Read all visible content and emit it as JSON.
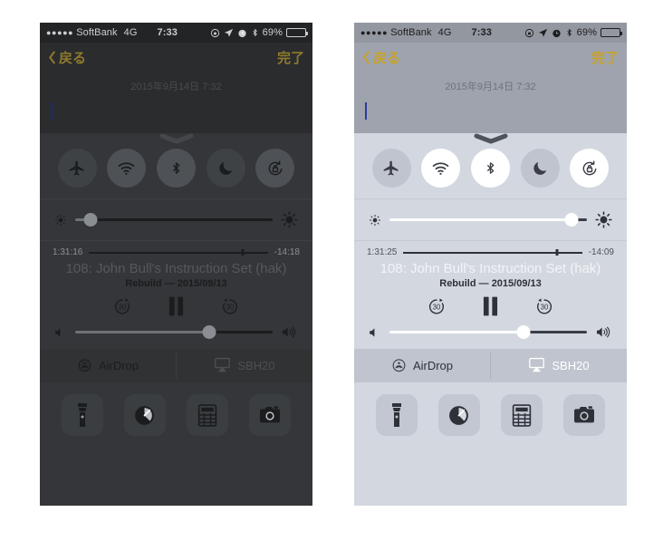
{
  "panels": [
    {
      "id": "left",
      "theme": "dark-dimmed",
      "status_bar": {
        "signal_dots": "●●●●●",
        "carrier": "SoftBank",
        "network": "4G",
        "time": "7:33",
        "battery_percent": "69%",
        "battery_level": 69,
        "icons": [
          "rotation-lock-icon",
          "location-arrow-icon",
          "alarm-clock-icon",
          "bluetooth-icon",
          "battery-icon"
        ]
      },
      "nav_bar": {
        "back_label": "戻る",
        "done_label": "完了"
      },
      "note": {
        "date_text": "2015年9月14日 7:32",
        "cursor_visible": true
      },
      "control_center": {
        "toggles": [
          {
            "name": "airplane-mode",
            "icon": "airplane-icon",
            "on": false
          },
          {
            "name": "wifi",
            "icon": "wifi-icon",
            "on": true
          },
          {
            "name": "bluetooth",
            "icon": "bluetooth-icon",
            "on": true
          },
          {
            "name": "do-not-disturb",
            "icon": "moon-icon",
            "on": false
          },
          {
            "name": "rotation-lock",
            "icon": "rotation-lock-icon",
            "on": true
          }
        ],
        "brightness": {
          "value": 8
        },
        "media": {
          "elapsed": "1:31:16",
          "remaining": "-14:18",
          "progress": 86,
          "title": "108: John Bull's Instruction Set (hak)",
          "subtitle": "Rebuild — 2015/09/13",
          "skip_back_label": "30",
          "skip_forward_label": "30",
          "playback_state": "playing"
        },
        "volume": {
          "value": 68
        },
        "share": {
          "airdrop_label": "AirDrop",
          "airplay_label": "SBH20"
        },
        "shortcuts": [
          {
            "name": "flashlight",
            "icon": "flashlight-icon"
          },
          {
            "name": "timer",
            "icon": "timer-icon"
          },
          {
            "name": "calculator",
            "icon": "calculator-icon"
          },
          {
            "name": "camera",
            "icon": "camera-icon"
          }
        ]
      }
    },
    {
      "id": "right",
      "theme": "light",
      "status_bar": {
        "signal_dots": "●●●●●",
        "carrier": "SoftBank",
        "network": "4G",
        "time": "7:33",
        "battery_percent": "69%",
        "battery_level": 69,
        "icons": [
          "rotation-lock-icon",
          "location-arrow-icon",
          "alarm-clock-icon",
          "bluetooth-icon",
          "battery-icon"
        ]
      },
      "nav_bar": {
        "back_label": "戻る",
        "done_label": "完了"
      },
      "note": {
        "date_text": "2015年9月14日 7:32",
        "cursor_visible": true
      },
      "control_center": {
        "toggles": [
          {
            "name": "airplane-mode",
            "icon": "airplane-icon",
            "on": false
          },
          {
            "name": "wifi",
            "icon": "wifi-icon",
            "on": true
          },
          {
            "name": "bluetooth",
            "icon": "bluetooth-icon",
            "on": true
          },
          {
            "name": "do-not-disturb",
            "icon": "moon-icon",
            "on": false
          },
          {
            "name": "rotation-lock",
            "icon": "rotation-lock-icon",
            "on": true
          }
        ],
        "brightness": {
          "value": 92
        },
        "media": {
          "elapsed": "1:31:25",
          "remaining": "-14:09",
          "progress": 86,
          "title": "108: John Bull's Instruction Set (hak)",
          "subtitle": "Rebuild — 2015/09/13",
          "skip_back_label": "30",
          "skip_forward_label": "30",
          "playback_state": "playing"
        },
        "volume": {
          "value": 68
        },
        "share": {
          "airdrop_label": "AirDrop",
          "airplay_label": "SBH20"
        },
        "shortcuts": [
          {
            "name": "flashlight",
            "icon": "flashlight-icon"
          },
          {
            "name": "timer",
            "icon": "timer-icon"
          },
          {
            "name": "calculator",
            "icon": "calculator-icon"
          },
          {
            "name": "camera",
            "icon": "camera-icon"
          }
        ]
      }
    }
  ],
  "colors": {
    "background": "#ffffff",
    "accent_gold": "#c9a227",
    "light_panel": "#d3d7e0",
    "dark_panel": "#343639",
    "cursor_blue": "#2a3a9e"
  }
}
